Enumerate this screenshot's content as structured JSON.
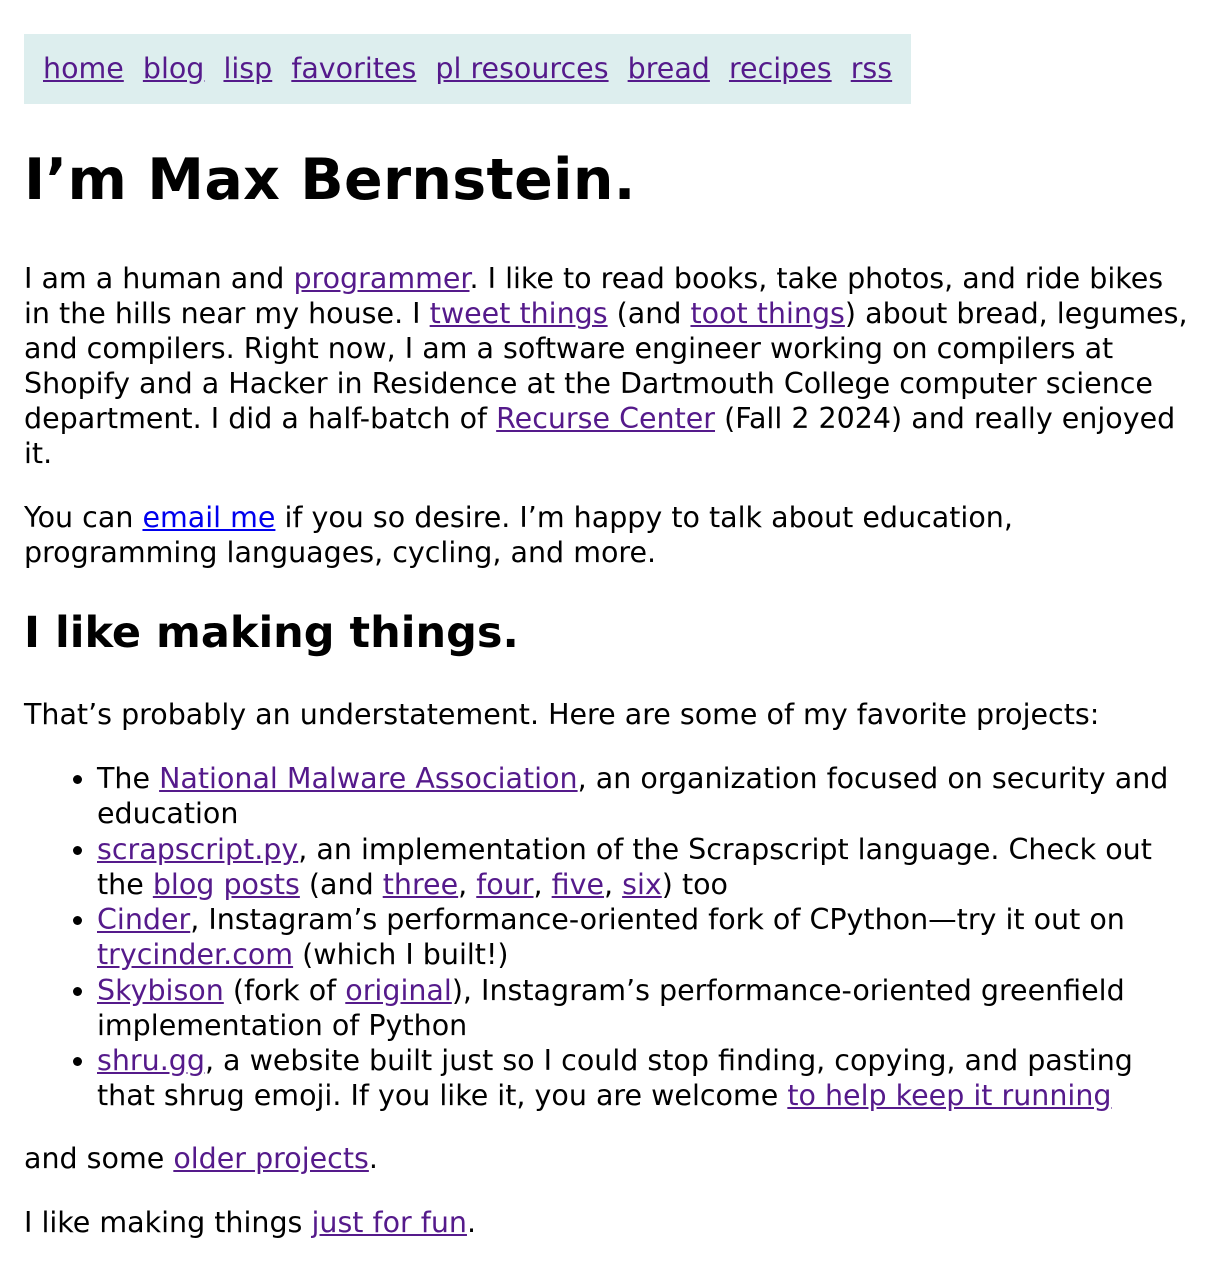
{
  "nav": {
    "items": [
      "home",
      "blog",
      "lisp",
      "favorites",
      "pl resources",
      "bread",
      "recipes",
      "rss"
    ]
  },
  "heading": "I’m Max Bernstein.",
  "intro": {
    "t1": "I am a human and ",
    "programmer": "programmer",
    "t2": ". I like to read books, take photos, and ride bikes in the hills near my house. I ",
    "tweet": "tweet things",
    "t3": " (and ",
    "toot": "toot things",
    "t4": ") about bread, legumes, and compilers. Right now, I am a software engineer working on compilers at Shopify and a Hacker in Residence at the Dartmouth College computer science department. I did a half-batch of ",
    "recurse": "Recurse Center",
    "t5": " (Fall 2 2024) and really enjoyed it."
  },
  "email_para": {
    "t1": "You can ",
    "link": "email me",
    "t2": " if you so desire. I’m happy to talk about education, programming languages, cycling, and more."
  },
  "section_heading": "I like making things.",
  "understatement": "That’s probably an understatement. Here are some of my favorite projects:",
  "projects": {
    "p1": {
      "t1": "The ",
      "link": "National Malware Association",
      "t2": ", an organization focused on security and education"
    },
    "p2": {
      "link": "scrapscript.py",
      "t1": ", an implementation of the Scrapscript language. Check out the ",
      "blog": "blog",
      "posts": "posts",
      "t2": " (and ",
      "three": "three",
      "four": "four",
      "five": "five",
      "six": "six",
      "t3": ") too",
      "comma": ", "
    },
    "p3": {
      "link": "Cinder",
      "t1": ", Instagram’s performance-oriented fork of CPython—try it out on ",
      "trycinder": "trycinder.com",
      "t2": " (which I built!)"
    },
    "p4": {
      "link": "Skybison",
      "t1": " (fork of ",
      "original": "original",
      "t2": "), Instagram’s performance-oriented greenfield implementation of Python"
    },
    "p5": {
      "link": "shru.gg",
      "t1": ", a website built just so I could stop finding, copying, and pasting that shrug emoji. If you like it, you are welcome ",
      "help": "to help keep it running"
    }
  },
  "older": {
    "t1": "and some ",
    "link": "older projects",
    "t2": "."
  },
  "fun": {
    "t1": "I like making things ",
    "link": "just for fun",
    "t2": "."
  },
  "colors": {
    "nav_background": "#ddeeee",
    "visited_link": "#551a8b",
    "unvisited_link": "#0000ee",
    "text": "#000000"
  }
}
